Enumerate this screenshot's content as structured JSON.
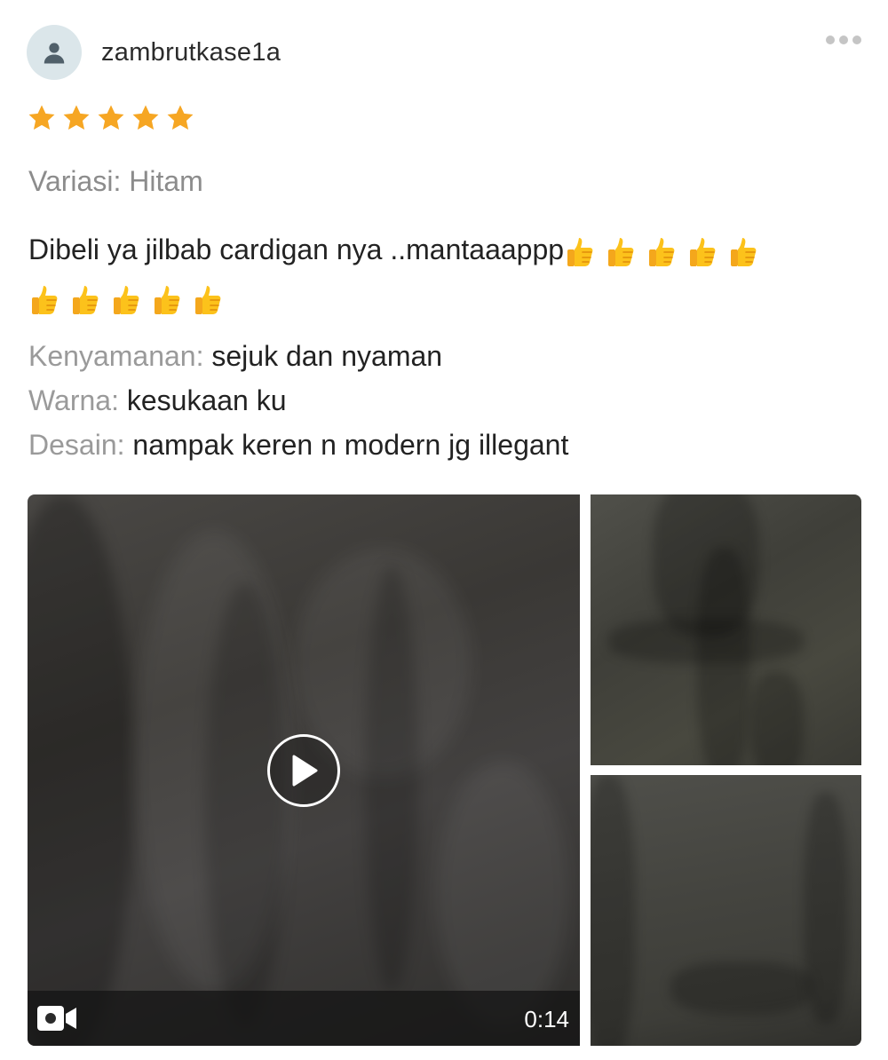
{
  "review": {
    "username": "zambrutkase1a",
    "rating": 5,
    "rating_max": 5,
    "variation": "Variasi: Hitam",
    "comment": "Dibeli ya jilbab cardigan nya ..mantaaappp",
    "thumbs_up_count": 10,
    "attributes": [
      {
        "label": "Kenyamanan:",
        "value": "sejuk dan nyaman"
      },
      {
        "label": "Warna:",
        "value": "kesukaan ku"
      },
      {
        "label": "Desain:",
        "value": "nampak keren n modern jg illegant"
      }
    ],
    "video": {
      "duration": "0:14"
    }
  },
  "icons": {
    "avatar": "user-silhouette-icon",
    "more": "more-dots-icon",
    "star": "star-icon",
    "play": "play-icon",
    "video": "video-camera-icon",
    "emoji": "thumbs-up-emoji"
  },
  "colors": {
    "star": "#f6a623",
    "label": "#9a9a9a",
    "text": "#222222"
  }
}
